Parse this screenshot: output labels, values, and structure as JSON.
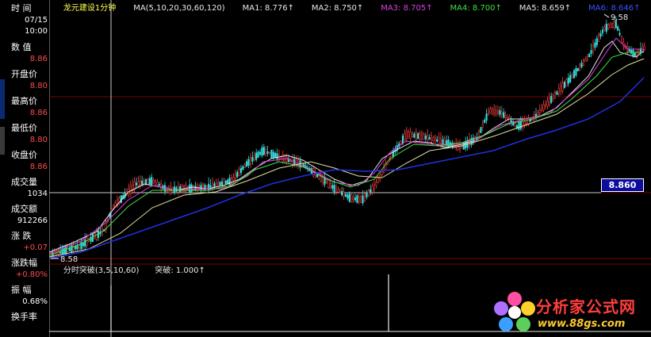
{
  "header": {
    "stock_name": "龙元建设1分钟",
    "ma_params": "MA(5,10,20,30,60,120)",
    "ma_items": [
      {
        "label": "MA1: 8.776↑",
        "color": "#e8e8e8"
      },
      {
        "label": "MA2: 8.750↑",
        "color": "#e8e8e8"
      },
      {
        "label": "MA3: 8.705↑",
        "color": "#e040e0"
      },
      {
        "label": "MA4: 8.700↑",
        "color": "#40e040"
      },
      {
        "label": "MA5: 8.659↑",
        "color": "#e8e8e8"
      },
      {
        "label": "MA6: 8.646↑",
        "color": "#3a50ff"
      }
    ]
  },
  "info_panel": {
    "time_label": "时 间",
    "date": "07/15",
    "time": "10:00",
    "value_label": "数 值",
    "value": "8.86",
    "open_label": "开盘价",
    "open": "8.80",
    "high_label": "最高价",
    "high": "8.86",
    "low_label": "最低价",
    "low": "8.80",
    "close_label": "收盘价",
    "close": "8.86",
    "volume_label": "成交量",
    "volume": "1034",
    "amount_label": "成交额",
    "amount": "912266",
    "change_label": "涨 跌",
    "change": "+0.07",
    "change_pct_label": "涨跌幅",
    "change_pct": "+0.80%",
    "amplitude_label": "振 幅",
    "amplitude": "0.68%",
    "turnover_label": "换手率"
  },
  "price_chart": {
    "high_mark": "9.58",
    "low_mark": "8.58",
    "current_price": "8.860",
    "colors": {
      "up": "#ff4040",
      "down": "#30e0e0",
      "ma1": "#e8e8e8",
      "ma3": "#e040e0",
      "ma4": "#40e040",
      "ma6": "#2030e0"
    }
  },
  "indicator": {
    "title": "分时突破(3,5,10,60)",
    "breakout_label": "突破: 1.000↑"
  },
  "watermark": {
    "cn": "分析家公式网",
    "url": "www.88gs.com"
  }
}
